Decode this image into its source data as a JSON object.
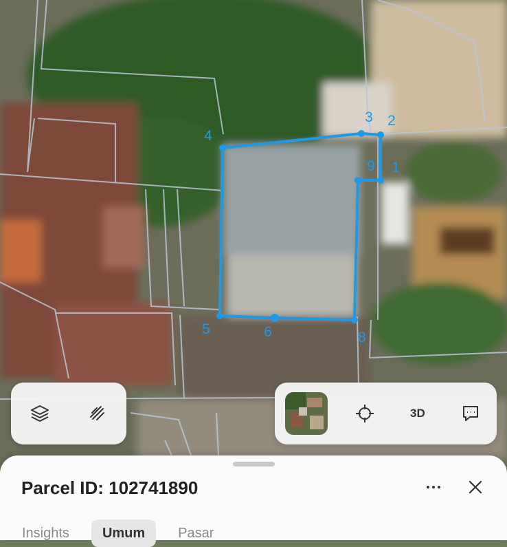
{
  "map": {
    "parcel_color": "#1f98e8",
    "vertex_labels": [
      "1",
      "2",
      "3",
      "4",
      "5",
      "6",
      "8",
      "9"
    ]
  },
  "toolbar_left": {
    "icons": [
      "layers-icon",
      "draw-line-icon"
    ]
  },
  "toolbar_right": {
    "icons": [
      "satellite-thumbnail",
      "locate-icon",
      "3d-toggle",
      "feedback-icon"
    ],
    "label_3d": "3D"
  },
  "sheet": {
    "title": "Parcel ID: 102741890",
    "tabs": [
      {
        "label": "Insights",
        "active": false
      },
      {
        "label": "Umum",
        "active": true
      },
      {
        "label": "Pasar",
        "active": false
      }
    ]
  }
}
